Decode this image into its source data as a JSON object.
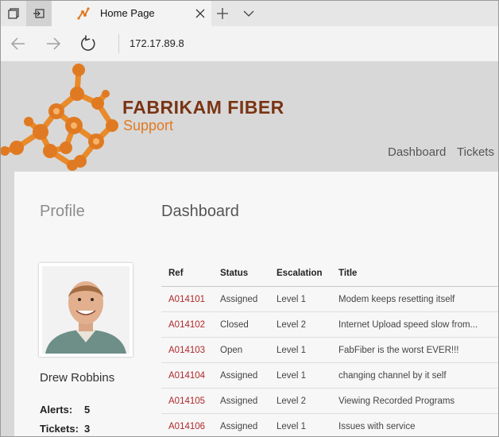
{
  "browser": {
    "tab_title": "Home Page",
    "address": "172.17.89.8"
  },
  "site": {
    "brand_title": "FABRIKAM FIBER",
    "brand_subtitle": "Support",
    "nav": [
      "Dashboard",
      "Tickets"
    ]
  },
  "profile": {
    "heading": "Profile",
    "name": "Drew Robbins",
    "stats": [
      {
        "label": "Alerts:",
        "value": "5"
      },
      {
        "label": "Tickets:",
        "value": "3"
      }
    ]
  },
  "dashboard": {
    "heading": "Dashboard",
    "columns": [
      "Ref",
      "Status",
      "Escalation",
      "Title"
    ],
    "rows": [
      {
        "ref": "A014101",
        "status": "Assigned",
        "escalation": "Level 1",
        "title": "Modem keeps resetting itself"
      },
      {
        "ref": "A014102",
        "status": "Closed",
        "escalation": "Level 2",
        "title": "Internet Upload speed slow from..."
      },
      {
        "ref": "A014103",
        "status": "Open",
        "escalation": "Level 1",
        "title": "FabFiber is the worst EVER!!!"
      },
      {
        "ref": "A014104",
        "status": "Assigned",
        "escalation": "Level 1",
        "title": "changing channel by it self"
      },
      {
        "ref": "A014105",
        "status": "Assigned",
        "escalation": "Level 2",
        "title": "Viewing Recorded Programs"
      },
      {
        "ref": "A014106",
        "status": "Assigned",
        "escalation": "Level 1",
        "title": "Issues with service"
      }
    ]
  },
  "colors": {
    "brand_dark": "#7a3414",
    "brand_orange": "#e07a22",
    "ref_link": "#b0282b"
  }
}
